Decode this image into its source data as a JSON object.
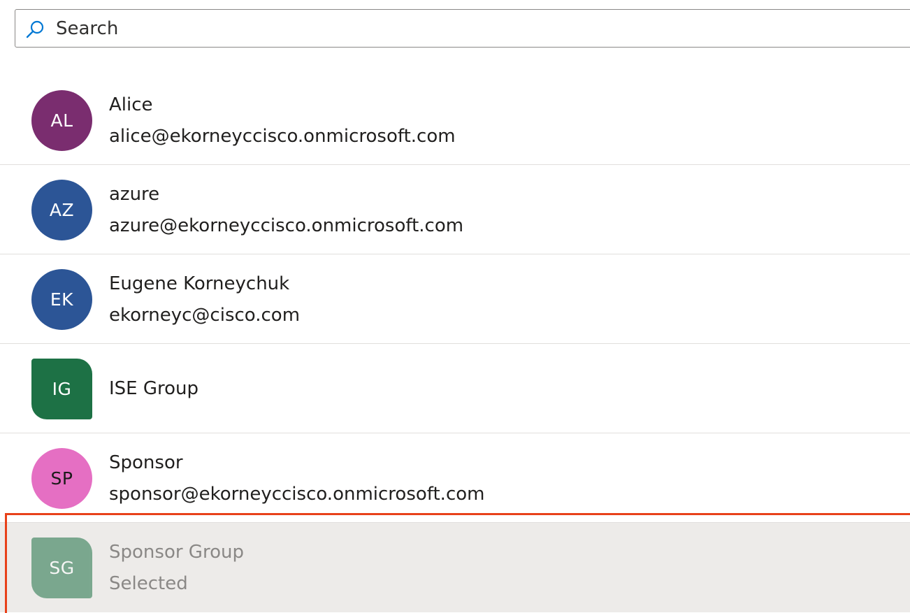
{
  "search": {
    "placeholder": "Search",
    "value": ""
  },
  "colors": {
    "highlight_border": "#e8411a",
    "selected_row_bg": "#edebe9"
  },
  "items": [
    {
      "initials": "AL",
      "name": "Alice",
      "detail": "alice@ekorneyccisco.onmicrosoft.com",
      "type": "user",
      "avatar_color": "#7a2d6f",
      "selected": false
    },
    {
      "initials": "AZ",
      "name": "azure",
      "detail": "azure@ekorneyccisco.onmicrosoft.com",
      "type": "user",
      "avatar_color": "#2c5596",
      "selected": false
    },
    {
      "initials": "EK",
      "name": "Eugene Korneychuk",
      "detail": "ekorneyc@cisco.com",
      "type": "user",
      "avatar_color": "#2c5596",
      "selected": false
    },
    {
      "initials": "IG",
      "name": "ISE Group",
      "detail": "",
      "type": "group",
      "avatar_color": "#1d7145",
      "selected": false
    },
    {
      "initials": "SP",
      "name": "Sponsor",
      "detail": "sponsor@ekorneyccisco.onmicrosoft.com",
      "type": "user",
      "avatar_color": "#e56fc3",
      "selected": false
    },
    {
      "initials": "SG",
      "name": "Sponsor Group",
      "detail": "Selected",
      "type": "group",
      "avatar_color": "#1d7145",
      "selected": true
    }
  ]
}
